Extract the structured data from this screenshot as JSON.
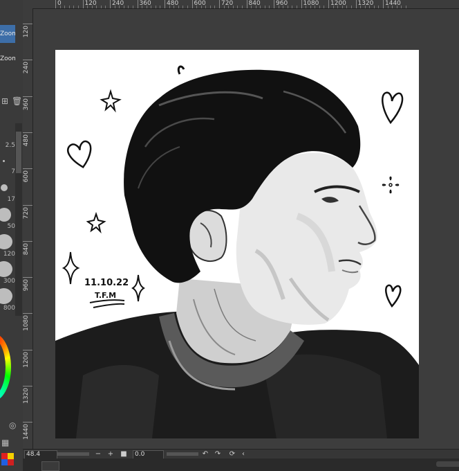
{
  "left_panel": {
    "zoom_in_label": "Zoom In",
    "zoom_out_label": "Zoom Out",
    "brush_sizes": [
      "2.5",
      "7",
      "17",
      "50",
      "120",
      "300",
      "800"
    ]
  },
  "rulers": {
    "horizontal": [
      "0",
      "120",
      "240",
      "360",
      "480",
      "600",
      "720",
      "840",
      "960",
      "1080",
      "1200",
      "1320",
      "1440"
    ],
    "vertical": [
      "120",
      "240",
      "360",
      "480",
      "600",
      "720",
      "840",
      "960",
      "1080",
      "1200",
      "1320",
      "1440"
    ]
  },
  "artwork": {
    "date_text": "11.10.22",
    "signature": "T.F.M"
  },
  "status_bar": {
    "zoom_value": "48.4",
    "rotation_value": "0.0"
  },
  "colors": {
    "ui_bg": "#2b2b2b",
    "panel_bg": "#3a3a3a",
    "accent": "#3d6ea8",
    "canvas_bg": "#ffffff"
  }
}
